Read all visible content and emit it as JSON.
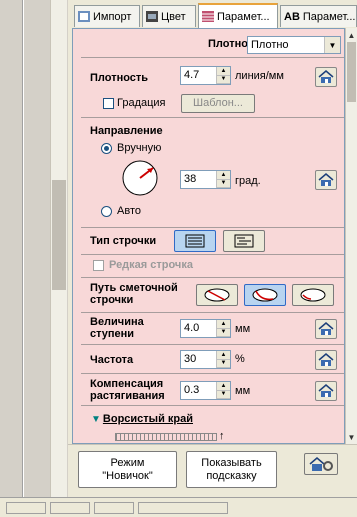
{
  "tabs": [
    {
      "label": "Импорт"
    },
    {
      "label": "Цвет"
    },
    {
      "label": "Парамет..."
    },
    {
      "label": "Парамет..."
    }
  ],
  "density_header": {
    "label": "Плотность",
    "select_value": "Плотно"
  },
  "density": {
    "label": "Плотность",
    "value": "4.7",
    "unit": "линия/мм"
  },
  "gradient": {
    "label": "Градация",
    "template_button": "Шаблон..."
  },
  "direction": {
    "label": "Направление",
    "manual_label": "Вручную",
    "value": "38",
    "unit": "град.",
    "auto_label": "Авто"
  },
  "stitch_type": {
    "label": "Тип строчки"
  },
  "sparse_stitch": {
    "label": "Редкая строчка"
  },
  "stitch_path": {
    "label_line1": "Путь сметочной",
    "label_line2": "строчки"
  },
  "step": {
    "label_line1": "Величина",
    "label_line2": "ступени",
    "value": "4.0",
    "unit": "мм"
  },
  "frequency": {
    "label": "Частота",
    "value": "30",
    "unit": "%"
  },
  "compensation": {
    "label_line1": "Компенсация",
    "label_line2": "растягивания",
    "value": "0.3",
    "unit": "мм"
  },
  "fringe": {
    "label": "Ворсистый край"
  },
  "buttons": {
    "novice_line1": "Режим",
    "novice_line2": "\"Новичок\"",
    "hints_line1": "Показывать",
    "hints_line2": "подсказку"
  },
  "colors": {
    "panel": "#f8d8d8",
    "accent": "#1c5180",
    "tab_highlight": "#e8a33b"
  }
}
